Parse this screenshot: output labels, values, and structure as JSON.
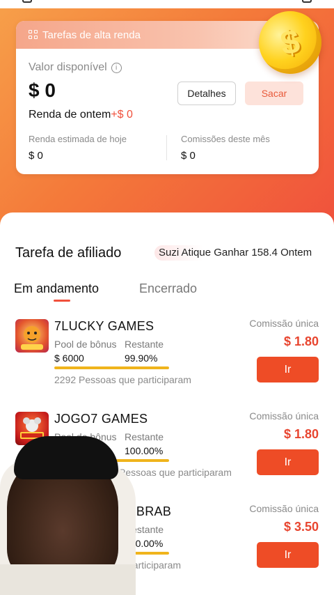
{
  "colors": {
    "accent": "#f0503c",
    "button": "#ee4c26",
    "progress": "#f0b41c"
  },
  "card": {
    "header": "Tarefas de alta renda",
    "label_available": "Valor disponível",
    "available_value": "$ 0",
    "details_button": "Detalhes",
    "withdraw_button": "Sacar",
    "yesterday_label": "Renda de ontem",
    "yesterday_value": "+$ 0",
    "today_label": "Renda estimada de hoje",
    "today_value": "$ 0",
    "month_label": "Comissões deste mês",
    "month_value": "$ 0",
    "coin_symbol": "$"
  },
  "section": {
    "title": "Tarefa de afiliado",
    "ticker": "Suzi Atique Ganhar 158.4 Ontem"
  },
  "tabs": [
    {
      "label": "Em andamento",
      "active": true
    },
    {
      "label": "Encerrado",
      "active": false
    }
  ],
  "tasks": [
    {
      "name": "7LUCKY GAMES",
      "pool_label": "Pool de bônus",
      "pool_value": "$ 6000",
      "remaining_label": "Restante",
      "remaining_value": "99.90%",
      "remaining_fraction": 0.999,
      "participants": "2292 Pessoas que participaram",
      "commission_label": "Comissão única",
      "commission_value": "$ 1.80",
      "button": "Ir",
      "thumb_icon": "tiger-game-icon"
    },
    {
      "name": "JOGO7 GAMES",
      "pool_label": "Pool de bônus",
      "pool_value": "",
      "remaining_label": "Restante",
      "remaining_value": "100.00%",
      "remaining_fraction": 1.0,
      "participants": "Pessoas que participaram",
      "commission_label": "Comissão única",
      "commission_value": "$ 1.80",
      "button": "Ir",
      "thumb_icon": "mouse-fortune-game-icon"
    },
    {
      "name": "er BRAB",
      "pool_label": "",
      "pool_value": "",
      "remaining_label": "Restante",
      "remaining_value": "100.00%",
      "remaining_fraction": 1.0,
      "participants": "participaram",
      "commission_label": "Comissão única",
      "commission_value": "$ 3.50",
      "button": "Ir",
      "thumb_icon": "game-thumb-icon"
    }
  ]
}
